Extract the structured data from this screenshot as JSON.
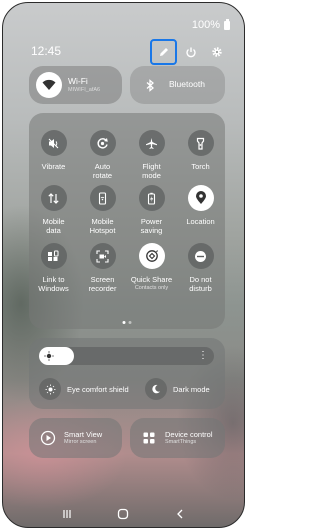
{
  "status": {
    "battery": "100%"
  },
  "clock": {
    "time": "12:45"
  },
  "top_icons": [
    "edit-icon",
    "power-icon",
    "settings-icon"
  ],
  "connectivity": {
    "wifi": {
      "title": "Wi-Fi",
      "subtitle": "MIWIFI_afA6",
      "state": "on"
    },
    "bluetooth": {
      "title": "Bluetooth",
      "state": "off"
    }
  },
  "quick_settings": [
    {
      "label": "Vibrate",
      "icon": "vibrate-icon",
      "state": "off"
    },
    {
      "label": "Auto\nrotate",
      "icon": "auto-rotate-icon",
      "state": "off"
    },
    {
      "label": "Flight\nmode",
      "icon": "airplane-icon",
      "state": "off"
    },
    {
      "label": "Torch",
      "icon": "torch-icon",
      "state": "off"
    },
    {
      "label": "Mobile\ndata",
      "icon": "mobile-data-icon",
      "state": "off"
    },
    {
      "label": "Mobile\nHotspot",
      "icon": "hotspot-icon",
      "state": "off"
    },
    {
      "label": "Power\nsaving",
      "icon": "power-saving-icon",
      "state": "off"
    },
    {
      "label": "Location",
      "icon": "location-icon",
      "state": "on"
    },
    {
      "label": "Link to\nWindows",
      "icon": "link-to-windows-icon",
      "state": "off"
    },
    {
      "label": "Screen\nrecorder",
      "icon": "screen-recorder-icon",
      "state": "off"
    },
    {
      "label": "Quick Share",
      "sub": "Contacts only",
      "icon": "quick-share-icon",
      "state": "on"
    },
    {
      "label": "Do not\ndisturb",
      "icon": "do-not-disturb-icon",
      "state": "off"
    }
  ],
  "pager": {
    "pages": 2,
    "current": 1
  },
  "brightness": {
    "level": 0.2,
    "eye_comfort": "Eye comfort shield",
    "dark_mode": "Dark mode"
  },
  "bottom": {
    "smart_view": {
      "title": "Smart View",
      "subtitle": "Mirror screen"
    },
    "device_control": {
      "title": "Device control",
      "subtitle": "SmartThings"
    }
  },
  "nav": [
    "recents-icon",
    "home-icon",
    "back-icon"
  ],
  "colors": {
    "highlight": "#1977e8"
  }
}
